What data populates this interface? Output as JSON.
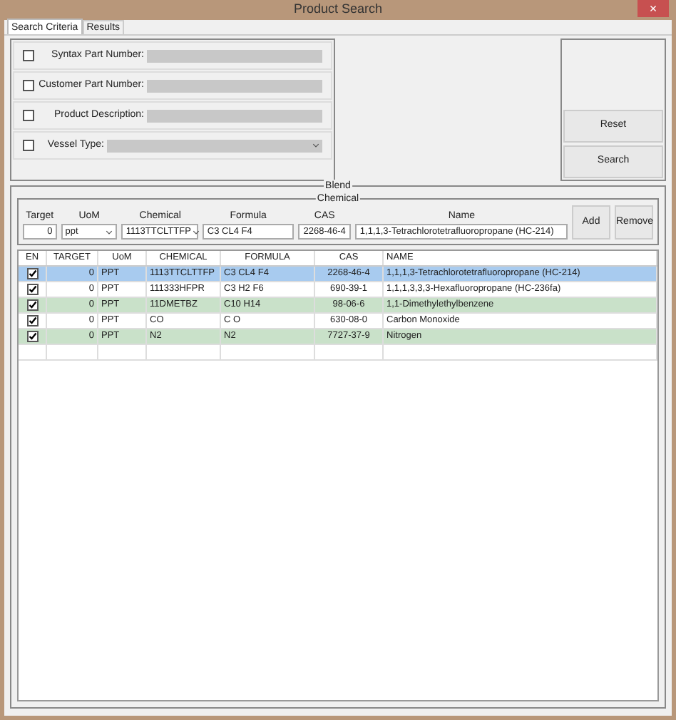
{
  "window": {
    "title": "Product Search",
    "close": "×"
  },
  "tabs": [
    {
      "label": "Search Criteria",
      "selected": true
    },
    {
      "label": "Results",
      "selected": false
    }
  ],
  "criteria": [
    {
      "label": "Syntax Part Number:",
      "checked": false,
      "kind": "text",
      "disabled": true
    },
    {
      "label": "Customer Part Number:",
      "checked": false,
      "kind": "text",
      "disabled": true
    },
    {
      "label": "Product Description:",
      "checked": false,
      "kind": "text",
      "disabled": true
    },
    {
      "label": "Vessel Type:",
      "checked": false,
      "kind": "dropdown",
      "disabled": true
    }
  ],
  "actions": [
    "Reset",
    "Search"
  ],
  "blend": {
    "legend": "Blend",
    "chemical": {
      "legend": "Chemical",
      "fields": [
        {
          "label": "Target",
          "value": "0",
          "kind": "number"
        },
        {
          "label": "UoM",
          "value": "ppt",
          "kind": "dropdown"
        },
        {
          "label": "Chemical",
          "value": "1113TTCLTTFP",
          "kind": "dropdown"
        },
        {
          "label": "Formula",
          "value": "C3 CL4 F4",
          "kind": "text"
        },
        {
          "label": "CAS",
          "value": "2268-46-4",
          "kind": "center"
        },
        {
          "label": "Name",
          "value": "1,1,1,3-Tetrachlorotetrafluoropropane (HC-214)",
          "kind": "text"
        }
      ],
      "buttons": [
        "Add",
        "Remove"
      ]
    },
    "table": {
      "enabled_header": "EN",
      "columns": [
        "TARGET",
        "UoM",
        "CHEMICAL",
        "FORMULA",
        "CAS",
        "NAME"
      ],
      "rows": [
        {
          "enabled": true,
          "selected": true,
          "cells": [
            "0",
            "PPT",
            "1113TTCLTTFP",
            "C3 CL4 F4",
            "2268-46-4",
            "1,1,1,3-Tetrachlorotetrafluoropropane (HC-214)"
          ]
        },
        {
          "enabled": true,
          "selected": false,
          "cells": [
            "0",
            "PPT",
            "111333HFPR",
            "C3 H2 F6",
            "690-39-1",
            "1,1,1,3,3,3-Hexafluoropropane (HC-236fa)"
          ]
        },
        {
          "enabled": true,
          "selected": false,
          "cells": [
            "0",
            "PPT",
            "11DMETBZ",
            "C10 H14",
            "98-06-6",
            "1,1-Dimethylethylbenzene"
          ]
        },
        {
          "enabled": true,
          "selected": false,
          "cells": [
            "0",
            "PPT",
            "CO",
            "C O",
            "630-08-0",
            "Carbon Monoxide"
          ]
        },
        {
          "enabled": true,
          "selected": false,
          "cells": [
            "0",
            "PPT",
            "N2",
            "N2",
            "7727-37-9",
            "Nitrogen"
          ]
        }
      ]
    }
  }
}
